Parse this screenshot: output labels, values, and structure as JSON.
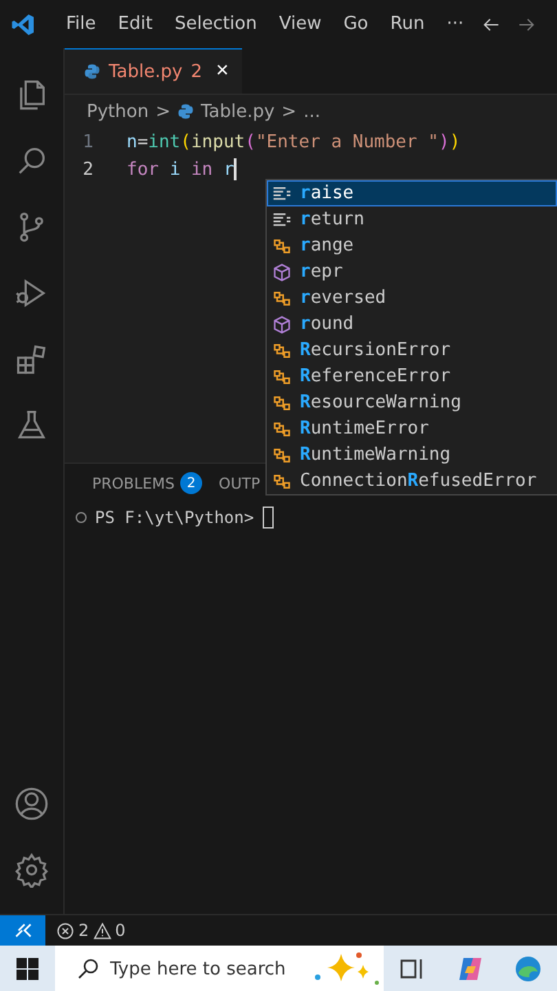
{
  "menu": {
    "items": [
      "File",
      "Edit",
      "Selection",
      "View",
      "Go",
      "Run",
      "···"
    ]
  },
  "tab": {
    "label": "Table.py",
    "problems": "2",
    "close": "×",
    "selected": true
  },
  "breadcrumbs": {
    "parts": [
      "Python",
      ">",
      "Table.py",
      ">",
      "..."
    ]
  },
  "code": {
    "lines": [
      {
        "number": "1",
        "active": false,
        "tokens": [
          {
            "text": "n",
            "kind": "variable"
          },
          {
            "text": "=",
            "kind": "plain"
          },
          {
            "text": "int",
            "kind": "class"
          },
          {
            "text": "(",
            "kind": "bracket"
          },
          {
            "text": "input",
            "kind": "function"
          },
          {
            "text": "(",
            "kind": "bracket2"
          },
          {
            "text": "\"Enter a Number \"",
            "kind": "string"
          },
          {
            "text": ")",
            "kind": "bracket2"
          },
          {
            "text": ")",
            "kind": "bracket"
          }
        ]
      },
      {
        "number": "2",
        "active": true,
        "tokens": [
          {
            "text": "for ",
            "kind": "keyword"
          },
          {
            "text": "i ",
            "kind": "variable"
          },
          {
            "text": "in ",
            "kind": "keyword"
          },
          {
            "text": "r",
            "kind": "variable"
          }
        ]
      }
    ]
  },
  "suggestions": [
    {
      "kind": "keyword",
      "match": "r",
      "suffix": "aise",
      "selected": true
    },
    {
      "kind": "keyword",
      "match": "r",
      "suffix": "eturn",
      "selected": false
    },
    {
      "kind": "class",
      "match": "r",
      "suffix": "ange",
      "selected": false
    },
    {
      "kind": "function",
      "match": "r",
      "suffix": "epr",
      "selected": false
    },
    {
      "kind": "class",
      "match": "r",
      "suffix": "eversed",
      "selected": false
    },
    {
      "kind": "function",
      "match": "r",
      "suffix": "ound",
      "selected": false
    },
    {
      "kind": "class",
      "match": "R",
      "suffix": "ecursionError",
      "selected": false
    },
    {
      "kind": "class",
      "match": "R",
      "suffix": "eferenceError",
      "selected": false
    },
    {
      "kind": "class",
      "match": "R",
      "suffix": "esourceWarning",
      "selected": false
    },
    {
      "kind": "class",
      "match": "R",
      "suffix": "untimeError",
      "selected": false
    },
    {
      "kind": "class",
      "match": "R",
      "suffix": "untimeWarning",
      "selected": false
    },
    {
      "kind": "class",
      "prefix": "Connection",
      "match": "R",
      "suffix": "efusedError",
      "selected": false
    }
  ],
  "panel": {
    "tabs": [
      {
        "label": "PROBLEMS",
        "badge": "2",
        "selected": false
      },
      {
        "label": "OUTP",
        "selected": false
      }
    ],
    "terminal": {
      "prompt": "PS F:\\yt\\Python>"
    }
  },
  "status_bar": {
    "errors": "2",
    "warnings": "0"
  },
  "taskbar": {
    "search": {
      "placeholder": "Type here to search"
    }
  }
}
